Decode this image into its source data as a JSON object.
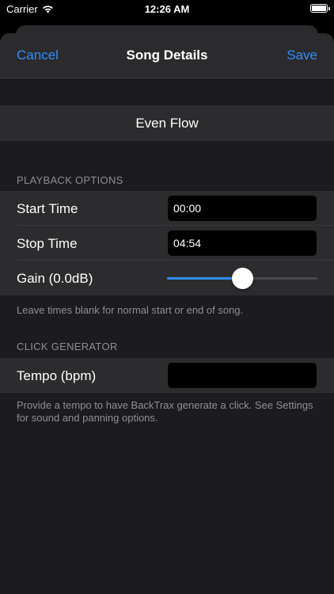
{
  "status": {
    "carrier": "Carrier",
    "time": "12:26 AM"
  },
  "nav": {
    "cancel": "Cancel",
    "title": "Song Details",
    "save": "Save"
  },
  "song": {
    "title": "Even Flow"
  },
  "playback": {
    "header": "PLAYBACK OPTIONS",
    "start_label": "Start Time",
    "start_value": "00:00",
    "stop_label": "Stop Time",
    "stop_value": "04:54",
    "gain_label": "Gain  (0.0dB)",
    "gain_slider_fraction": 0.5,
    "footer": "Leave times blank for normal start or end of song."
  },
  "click": {
    "header": "CLICK GENERATOR",
    "tempo_label": "Tempo (bpm)",
    "tempo_value": "",
    "footer": "Provide a tempo to have BackTrax generate a click. See Settings for sound and panning options."
  },
  "colors": {
    "accent": "#2f8cff",
    "background": "#1c1c1e",
    "cell": "#2c2c2e"
  }
}
